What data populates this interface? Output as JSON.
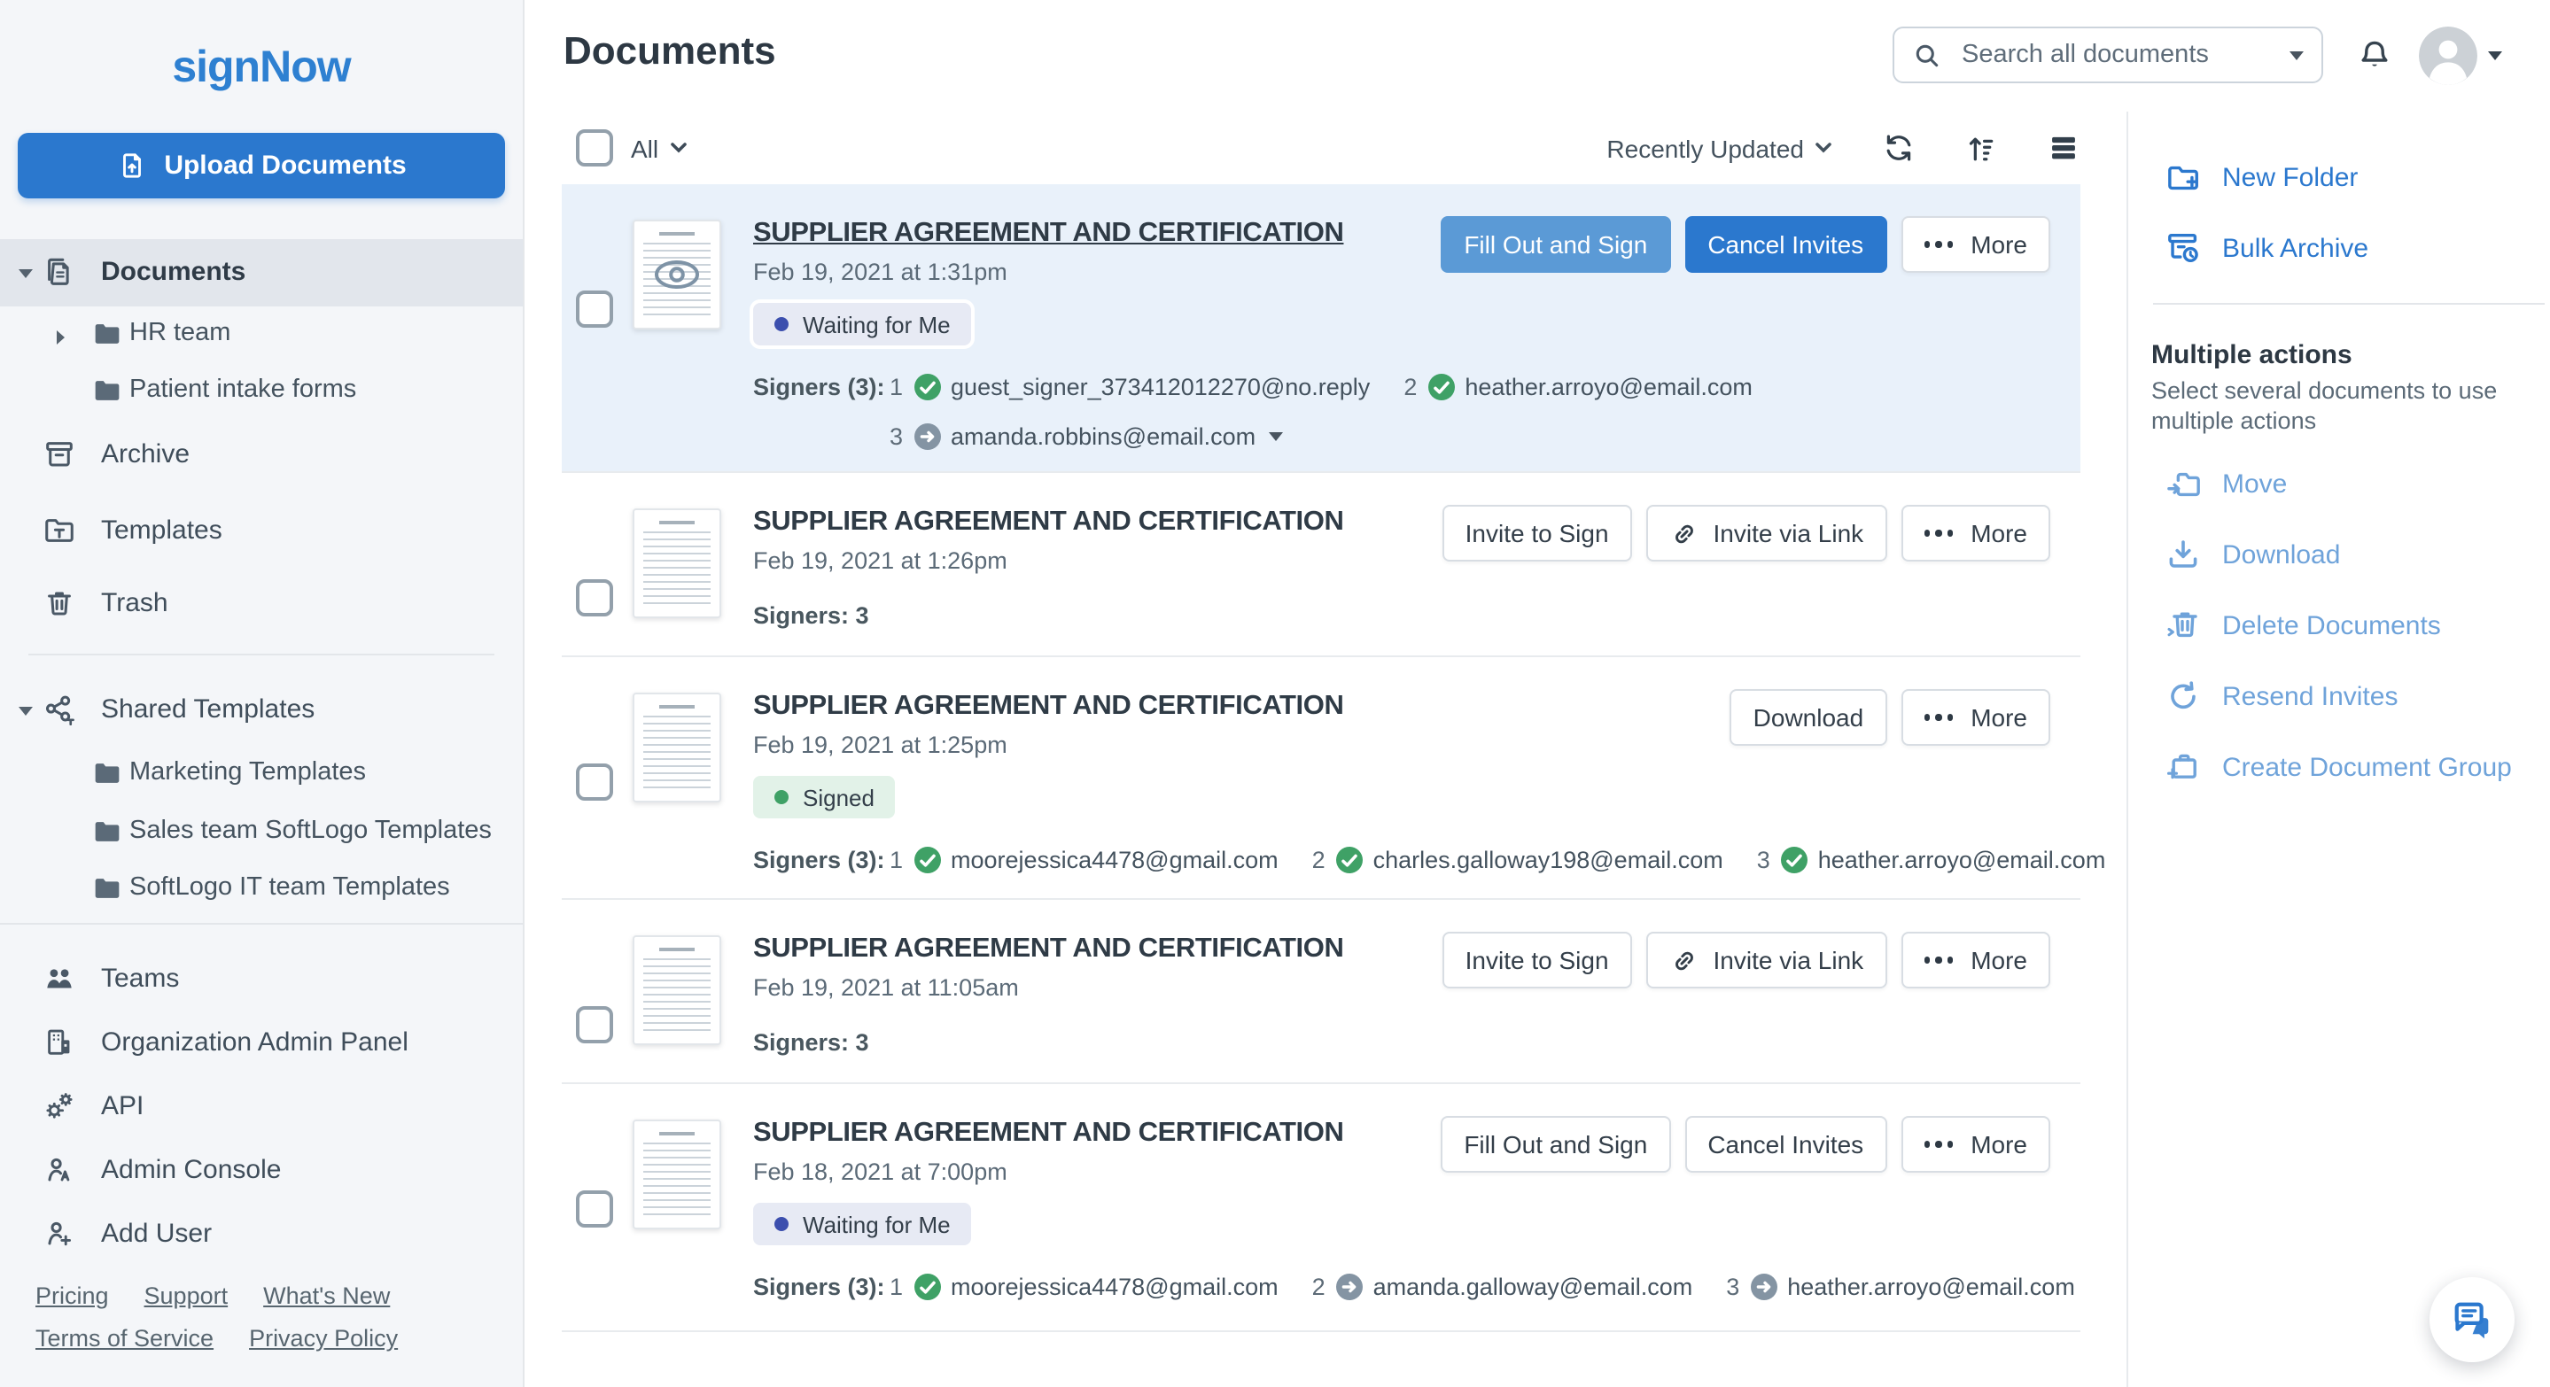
{
  "colors": {
    "accent": "#2b78ce",
    "accent_light": "#5b9ad6",
    "muted_action": "#6fa3da",
    "signed_green": "#3fa166",
    "waiting_indigo": "#3c4fae",
    "selected_row_bg": "#e9f1fa"
  },
  "brand": {
    "logo": "signNow"
  },
  "sidebar": {
    "upload_label": "Upload Documents",
    "nav": {
      "documents": "Documents",
      "hr_team": "HR team",
      "patient_intake": "Patient intake forms",
      "archive": "Archive",
      "templates": "Templates",
      "trash": "Trash",
      "shared_templates": "Shared Templates",
      "marketing_templates": "Marketing Templates",
      "sales_softlogo": "Sales team SoftLogo Templates",
      "softlogo_it": "SoftLogo IT team Templates",
      "teams": "Teams",
      "org_admin": "Organization Admin Panel",
      "api": "API",
      "admin_console": "Admin Console",
      "add_user": "Add User"
    },
    "footer_links": [
      "Pricing",
      "Support",
      "What's New",
      "Terms of Service",
      "Privacy Policy"
    ]
  },
  "header": {
    "title": "Documents",
    "search_placeholder": "Search all documents"
  },
  "toolbar": {
    "filter_label": "All",
    "sort_label": "Recently Updated"
  },
  "documents": [
    {
      "title": "SUPPLIER AGREEMENT AND CERTIFICATION",
      "date": "Feb 19, 2021 at 1:31pm",
      "badge": {
        "label": "Waiting for Me",
        "type": "waiting"
      },
      "signers_label": "Signers (3):",
      "signers": [
        {
          "n": "1",
          "status": "signed",
          "email": "guest_signer_373412012270@no.reply"
        },
        {
          "n": "2",
          "status": "signed",
          "email": "heather.arroyo@email.com"
        },
        {
          "n": "3",
          "status": "pending",
          "email": "amanda.robbins@email.com"
        }
      ],
      "buttons": [
        "Fill Out and Sign",
        "Cancel Invites",
        "More"
      ]
    },
    {
      "title": "SUPPLIER AGREEMENT AND CERTIFICATION",
      "date": "Feb 19, 2021 at 1:26pm",
      "signers_summary": "Signers: 3",
      "buttons": [
        "Invite to Sign",
        "Invite via Link",
        "More"
      ]
    },
    {
      "title": "SUPPLIER AGREEMENT AND CERTIFICATION",
      "date": "Feb 19, 2021 at 1:25pm",
      "badge": {
        "label": "Signed",
        "type": "signed"
      },
      "signers_label": "Signers (3):",
      "signers": [
        {
          "n": "1",
          "status": "signed",
          "email": "moorejessica4478@gmail.com"
        },
        {
          "n": "2",
          "status": "signed",
          "email": "charles.galloway198@email.com"
        },
        {
          "n": "3",
          "status": "signed",
          "email": "heather.arroyo@email.com"
        }
      ],
      "buttons": [
        "Download",
        "More"
      ]
    },
    {
      "title": "SUPPLIER AGREEMENT AND CERTIFICATION",
      "date": "Feb 19, 2021 at 11:05am",
      "signers_summary": "Signers: 3",
      "buttons": [
        "Invite to Sign",
        "Invite via Link",
        "More"
      ]
    },
    {
      "title": "SUPPLIER AGREEMENT AND CERTIFICATION",
      "date": "Feb 18, 2021 at 7:00pm",
      "badge": {
        "label": "Waiting for Me",
        "type": "waiting"
      },
      "signers_label": "Signers (3):",
      "signers": [
        {
          "n": "1",
          "status": "signed",
          "email": "moorejessica4478@gmail.com"
        },
        {
          "n": "2",
          "status": "pending",
          "email": "amanda.galloway@email.com"
        },
        {
          "n": "3",
          "status": "pending",
          "email": "heather.arroyo@email.com"
        }
      ],
      "buttons": [
        "Fill Out and Sign",
        "Cancel Invites",
        "More"
      ]
    }
  ],
  "right_panel": {
    "primary_actions": [
      "New Folder",
      "Bulk Archive"
    ],
    "heading": "Multiple actions",
    "note": "Select several documents to use multiple actions",
    "actions": [
      "Move",
      "Download",
      "Delete Documents",
      "Resend Invites",
      "Create Document Group"
    ]
  }
}
